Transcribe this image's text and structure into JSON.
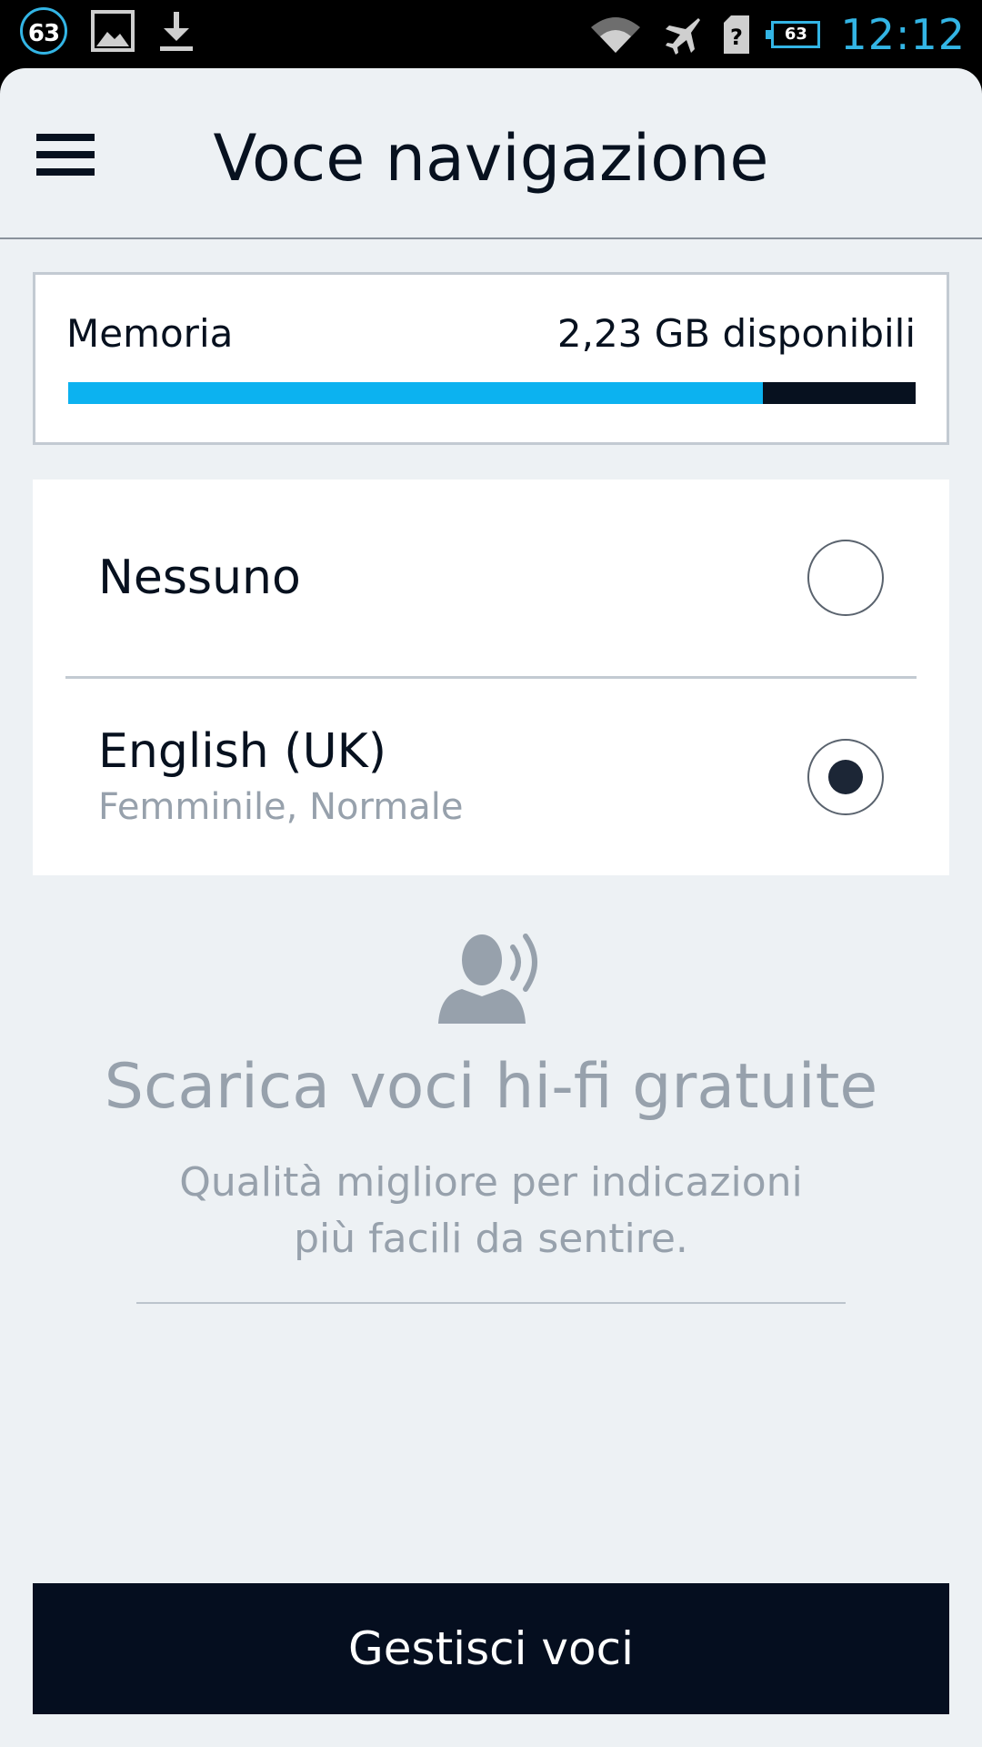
{
  "status_bar": {
    "notification_count": "63",
    "battery_level": "63",
    "time": "12:12",
    "icons": [
      "image-icon",
      "download-icon",
      "wifi-icon",
      "airplane-icon",
      "sim-icon",
      "battery-icon"
    ]
  },
  "header": {
    "title": "Voce navigazione",
    "menu_icon": "menu-icon"
  },
  "memory": {
    "label": "Memoria",
    "available": "2,23 GB disponibili",
    "used_fraction": 0.82,
    "fill_color": "#0cb2f0",
    "track_color": "#07111f"
  },
  "voices": [
    {
      "name": "Nessuno",
      "subtitle": "",
      "selected": false
    },
    {
      "name": "English (UK)",
      "subtitle": "Femminile, Normale",
      "selected": true
    }
  ],
  "promo": {
    "icon": "speaking-person-icon",
    "title": "Scarica voci hi-fi gratuite",
    "line1": "Qualità migliore per indicazioni",
    "line2": "più facili da sentire."
  },
  "footer": {
    "manage_label": "Gestisci voci"
  }
}
